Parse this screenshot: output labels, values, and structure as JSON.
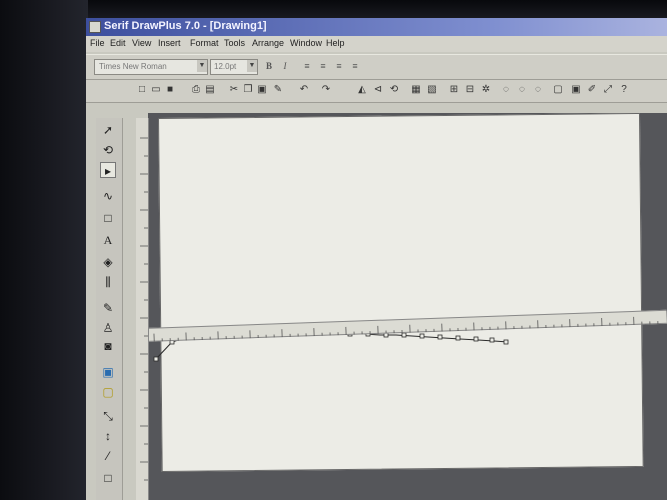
{
  "window": {
    "title": "Serif DrawPlus 7.0 - [Drawing1]"
  },
  "menu": {
    "items": [
      "File",
      "Edit",
      "View",
      "Insert",
      "Format",
      "Tools",
      "Arrange",
      "Window",
      "Help"
    ]
  },
  "text_toolbar": {
    "font": "Times New Roman",
    "size": "12.0pt",
    "bold_icon": "bold-icon",
    "italic_icon": "italic-icon",
    "align_icons": [
      "align-left-icon",
      "align-center-icon",
      "align-right-icon",
      "justify-icon"
    ]
  },
  "standard_toolbar": {
    "icons": [
      "new-icon",
      "open-icon",
      "save-icon",
      "print-icon",
      "print-preview-icon",
      "cut-icon",
      "copy-icon",
      "paste-icon",
      "format-painter-icon",
      "undo-icon",
      "redo-icon",
      "flip-horizontal-icon",
      "flip-vertical-icon",
      "rotate-icon",
      "bring-to-front-icon",
      "send-to-back-icon",
      "group-icon",
      "ungroup-icon",
      "combine-icon",
      "zoom-icon",
      "zoom-out-icon",
      "page-setup-icon",
      "help-icon"
    ]
  },
  "tools": {
    "items": [
      "pointer-tool-icon",
      "rotate-tool-icon",
      "node-tool-icon",
      "curve-tool-icon",
      "shape-tool-icon",
      "text-tool-icon",
      "fill-tool-icon",
      "transparency-tool-icon",
      "pen-tool-icon",
      "stamp-tool-icon",
      "color-fill-icon",
      "picture-tool-icon",
      "frame-tool-icon",
      "connector-tool-icon",
      "dimension-tool-icon",
      "pencil-tool-icon",
      "rectangle-tool-icon"
    ]
  },
  "colors": {
    "page": "#ecece6",
    "workspace": "#55565a",
    "title_start": "#3d4f9e"
  }
}
